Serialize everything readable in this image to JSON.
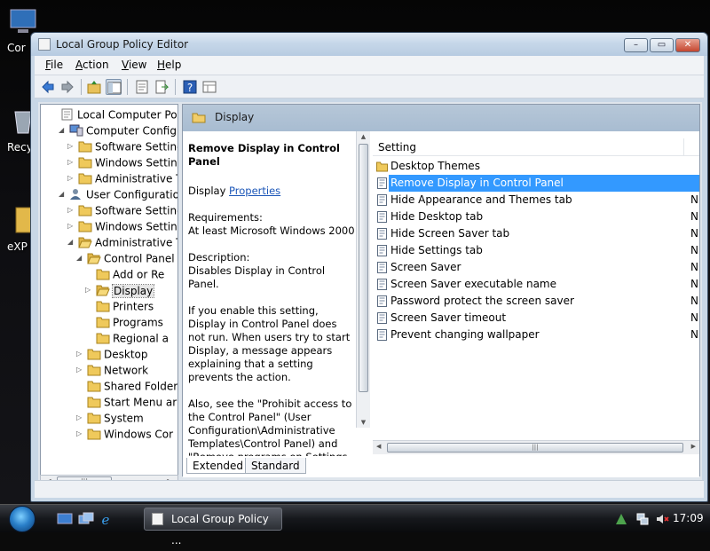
{
  "desktop": {
    "icons": [
      {
        "label": "Cor"
      },
      {
        "label": "Recy"
      },
      {
        "label": "eXP"
      }
    ]
  },
  "window": {
    "title": "Local Group Policy Editor",
    "menu": [
      {
        "label": "File",
        "key": "F",
        "rest": "ile"
      },
      {
        "label": "Action",
        "key": "A",
        "rest": "ction"
      },
      {
        "label": "View",
        "key": "V",
        "rest": "iew"
      },
      {
        "label": "Help",
        "key": "H",
        "rest": "elp"
      }
    ]
  },
  "tree": {
    "items": [
      {
        "label": "Local Computer Policy",
        "expander": "",
        "icon": "computer-policy-icon",
        "level": 0
      },
      {
        "label": "Computer Configura",
        "expander": "◢",
        "icon": "computer-icon",
        "level": 1
      },
      {
        "label": "Software Settings",
        "expander": "▷",
        "icon": "folder-icon",
        "level": 2
      },
      {
        "label": "Windows Setting",
        "expander": "▷",
        "icon": "folder-icon",
        "level": 2
      },
      {
        "label": "Administrative Te",
        "expander": "▷",
        "icon": "folder-icon",
        "level": 2
      },
      {
        "label": "User Configuration",
        "expander": "◢",
        "icon": "user-icon",
        "level": 1
      },
      {
        "label": "Software Settings",
        "expander": "▷",
        "icon": "folder-icon",
        "level": 2
      },
      {
        "label": "Windows Setting",
        "expander": "▷",
        "icon": "folder-icon",
        "level": 2
      },
      {
        "label": "Administrative Te",
        "expander": "◢",
        "icon": "folder-open-icon",
        "level": 2
      },
      {
        "label": "Control Panel",
        "expander": "◢",
        "icon": "folder-open-icon",
        "level": 3
      },
      {
        "label": "Add or Re",
        "expander": "",
        "icon": "folder-icon",
        "level": 4
      },
      {
        "label": "Display",
        "expander": "▷",
        "icon": "folder-open-icon",
        "level": 4,
        "selected": true
      },
      {
        "label": "Printers",
        "expander": "",
        "icon": "folder-icon",
        "level": 4
      },
      {
        "label": "Programs",
        "expander": "",
        "icon": "folder-icon",
        "level": 4
      },
      {
        "label": "Regional a",
        "expander": "",
        "icon": "folder-icon",
        "level": 4
      },
      {
        "label": "Desktop",
        "expander": "▷",
        "icon": "folder-icon",
        "level": 3
      },
      {
        "label": "Network",
        "expander": "▷",
        "icon": "folder-icon",
        "level": 3
      },
      {
        "label": "Shared Folder",
        "expander": "",
        "icon": "folder-icon",
        "level": 3
      },
      {
        "label": "Start Menu ar",
        "expander": "",
        "icon": "folder-icon",
        "level": 3
      },
      {
        "label": "System",
        "expander": "▷",
        "icon": "folder-icon",
        "level": 3
      },
      {
        "label": "Windows Cor",
        "expander": "▷",
        "icon": "folder-icon",
        "level": 3
      }
    ]
  },
  "pane": {
    "header_title": "Display",
    "description": {
      "heading": "Remove Display in Control Panel",
      "display_prefix": "Display",
      "properties_link": "Properties",
      "requirements_label": "Requirements:",
      "requirements_value": "At least Microsoft Windows 2000",
      "description_label": "Description:",
      "description_value": "Disables Display in Control Panel.",
      "para1": "If you enable this setting, Display in Control Panel does not run. When users try to start Display, a message appears explaining that a setting prevents the action.",
      "para2": "Also, see the \"Prohibit access to the Control Panel\" (User Configuration\\Administrative Templates\\Control Panel) and \"Remove programs on Settings menu\" (User Configuration\\Administrative Templates\\Start Menu & Taskbar)"
    },
    "list": {
      "column_setting": "Setting",
      "rows": [
        {
          "name": "Desktop Themes",
          "state": "",
          "type": "folder"
        },
        {
          "name": "Remove Display in Control Panel",
          "state": "",
          "type": "setting",
          "selected": true
        },
        {
          "name": "Hide Appearance and Themes tab",
          "state": "N",
          "type": "setting"
        },
        {
          "name": "Hide Desktop tab",
          "state": "N",
          "type": "setting"
        },
        {
          "name": "Hide Screen Saver tab",
          "state": "N",
          "type": "setting"
        },
        {
          "name": "Hide Settings tab",
          "state": "N",
          "type": "setting"
        },
        {
          "name": "Screen Saver",
          "state": "N",
          "type": "setting"
        },
        {
          "name": "Screen Saver executable name",
          "state": "N",
          "type": "setting"
        },
        {
          "name": "Password protect the screen saver",
          "state": "N",
          "type": "setting"
        },
        {
          "name": "Screen Saver timeout",
          "state": "N",
          "type": "setting"
        },
        {
          "name": "Prevent changing wallpaper",
          "state": "N",
          "type": "setting"
        }
      ]
    },
    "tabs": [
      {
        "label": "Extended"
      },
      {
        "label": "Standard"
      }
    ]
  },
  "taskbar": {
    "task_label": "Local Group Policy ...",
    "clock": "17:09"
  },
  "colors": {
    "selection": "#3399ff",
    "link": "#1b56b8",
    "pane_header": "#a8bcd1"
  }
}
